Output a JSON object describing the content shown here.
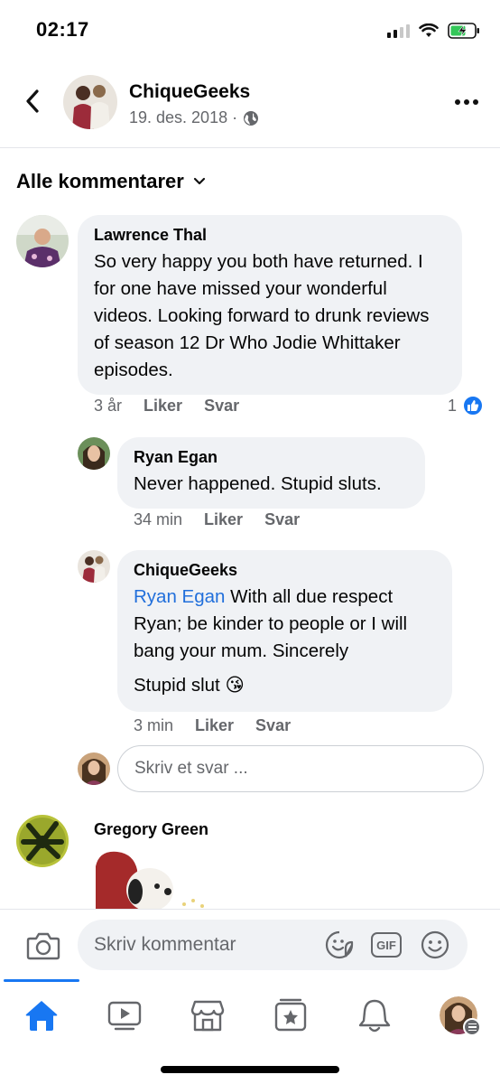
{
  "status": {
    "time": "02:17"
  },
  "header": {
    "page_name": "ChiqueGeeks",
    "date": "19. des. 2018 ·"
  },
  "filter": {
    "label": "Alle kommentarer"
  },
  "comments": [
    {
      "author": "Lawrence Thal",
      "text": "So very happy you both have returned. I for one have missed your wonderful videos.  Looking forward to drunk reviews of season 12 Dr Who Jodie Whittaker episodes.",
      "time": "3 år",
      "like_label": "Liker",
      "reply_label": "Svar",
      "reaction_count": "1"
    },
    {
      "author": "Ryan Egan",
      "text": "Never happened. Stupid sluts.",
      "time": "34 min",
      "like_label": "Liker",
      "reply_label": "Svar"
    },
    {
      "author": "ChiqueGeeks",
      "mention": "Ryan Egan",
      "text": " With all due respect Ryan; be kinder to people or I will bang your mum. Sincerely",
      "text2": "Stupid slut",
      "emoji": "😘",
      "time": "3 min",
      "like_label": "Liker",
      "reply_label": "Svar"
    },
    {
      "author": "Gregory Green"
    }
  ],
  "reply_input": {
    "placeholder": "Skriv et svar ..."
  },
  "composer": {
    "placeholder": "Skriv kommentar",
    "gif_label": "GIF"
  },
  "colors": {
    "accent": "#1877f2",
    "bubble": "#f0f2f5",
    "muted": "#65676b",
    "mention": "#216fdb"
  },
  "tabs": [
    {
      "icon": "home-icon",
      "active": true
    },
    {
      "icon": "video-icon"
    },
    {
      "icon": "marketplace-icon"
    },
    {
      "icon": "pages-icon"
    },
    {
      "icon": "bell-icon"
    },
    {
      "icon": "profile-menu-icon"
    }
  ]
}
